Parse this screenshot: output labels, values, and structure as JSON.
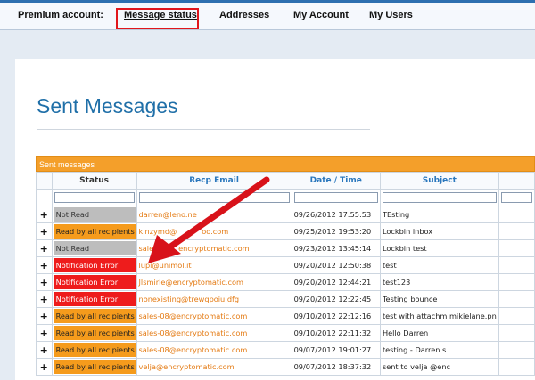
{
  "nav": {
    "premium_label": "Premium account:",
    "items": [
      "Message status",
      "Addresses",
      "My Account",
      "My Users"
    ]
  },
  "page": {
    "title": "Sent Messages"
  },
  "grid": {
    "caption": "Sent messages",
    "columns": [
      "Status",
      "Recp Email",
      "Date / Time",
      "Subject"
    ],
    "rows": [
      {
        "status": "Not Read",
        "status_type": "notread",
        "email": "darren@leno.ne",
        "date": "09/26/2012 17:55:53",
        "subject": "TEsting"
      },
      {
        "status": "Read by all recipients",
        "status_type": "read",
        "email": "kinzymd@",
        "date": "09/25/2012 19:53:20",
        "subject": "Lockbin inbox"
      },
      {
        "status": "Not Read",
        "status_type": "notread",
        "email": "sale",
        "date": "09/23/2012 13:45:14",
        "subject": "Lockbin test"
      },
      {
        "status": "Notification Error",
        "status_type": "error",
        "email": "lupi@unimol.it",
        "date": "09/20/2012 12:50:38",
        "subject": "test"
      },
      {
        "status": "Notification Error",
        "status_type": "error",
        "email": "Jlsmirle@encryptomatic.com",
        "date": "09/20/2012 12:44:21",
        "subject": "test123"
      },
      {
        "status": "Notification Error",
        "status_type": "error",
        "email": "nonexisting@trewqpoiu.dfg",
        "date": "09/20/2012 12:22:45",
        "subject": "Testing bounce"
      },
      {
        "status": "Read by all recipients",
        "status_type": "read",
        "email": "sales-08@encryptomatic.com",
        "date": "09/10/2012 22:12:16",
        "subject": "test with attachm mikielane.pn"
      },
      {
        "status": "Read by all recipients",
        "status_type": "read",
        "email": "sales-08@encryptomatic.com",
        "date": "09/10/2012 22:11:32",
        "subject": "Hello Darren"
      },
      {
        "status": "Read by all recipients",
        "status_type": "read",
        "email": "sales-08@encryptomatic.com",
        "date": "09/07/2012 19:01:27",
        "subject": "testing - Darren s"
      },
      {
        "status": "Read by all recipients",
        "status_type": "read",
        "email": "velja@encryptomatic.com",
        "date": "09/07/2012 18:37:32",
        "subject": "sent to velja @enc"
      }
    ],
    "row_extra": [
      "oo.com",
      "encryptomatic.com"
    ]
  },
  "colors": {
    "accent_blue": "#1f6fa8",
    "header_orange": "#f49f2a",
    "error_red": "#ee1c1c",
    "read_orange": "#f59b1c",
    "notread_grey": "#bdbdbd",
    "highlight_red": "#e1161c"
  },
  "icons": {
    "expand": "+"
  }
}
